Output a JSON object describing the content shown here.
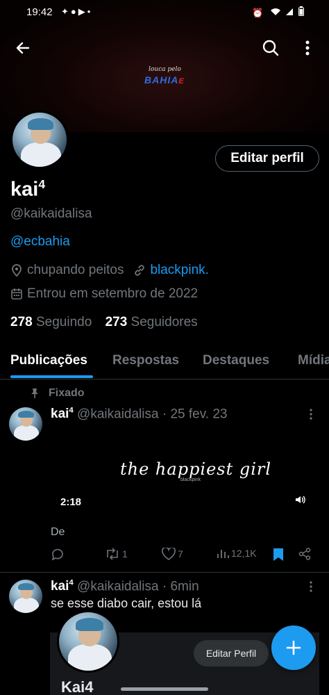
{
  "status_bar": {
    "time": "19:42",
    "notification_icons": [
      "butterfly-icon",
      "soccer-ball-icon",
      "youtube-icon",
      "dot-icon"
    ],
    "system_icons": [
      "alarm-icon",
      "wifi-icon",
      "signal-icon",
      "battery-icon"
    ]
  },
  "banner": {
    "line1": "louca pelo",
    "line2": "BAHIA",
    "line2_suffix": "E"
  },
  "profile": {
    "name": "kai",
    "name_sup": "4",
    "handle": "@kaikaidalisa",
    "bio_mention": "@ecbahia",
    "location": "chupando peitos",
    "website": "blackpink.",
    "joined": "Entrou em setembro de 2022",
    "following_count": "278",
    "following_label": "Seguindo",
    "followers_count": "273",
    "followers_label": "Seguidores",
    "edit_button": "Editar perfil"
  },
  "tabs": [
    "Publicações",
    "Respostas",
    "Destaques",
    "Mídia"
  ],
  "pinned_label": "Fixado",
  "tweets": [
    {
      "name": "kai",
      "name_sup": "4",
      "handle": "@kaikaidalisa",
      "time": "· 25 fev. 23",
      "video_text": "the happiest girl",
      "video_subtext": "blackpink",
      "duration": "2:18",
      "caption": "De",
      "stats": {
        "replies": "",
        "reposts": "1",
        "likes": "7",
        "views": "12,1K"
      }
    },
    {
      "name": "kai",
      "name_sup": "4",
      "handle": "@kaikaidalisa",
      "time": "· 6min",
      "text": "se esse diabo cair, estou lá"
    }
  ],
  "preview": {
    "button": "Editar Perfil",
    "name": "Kai4"
  },
  "colors": {
    "accent": "#1d9bf0",
    "background": "#000000",
    "muted": "#71767b",
    "divider": "#2f3336"
  }
}
